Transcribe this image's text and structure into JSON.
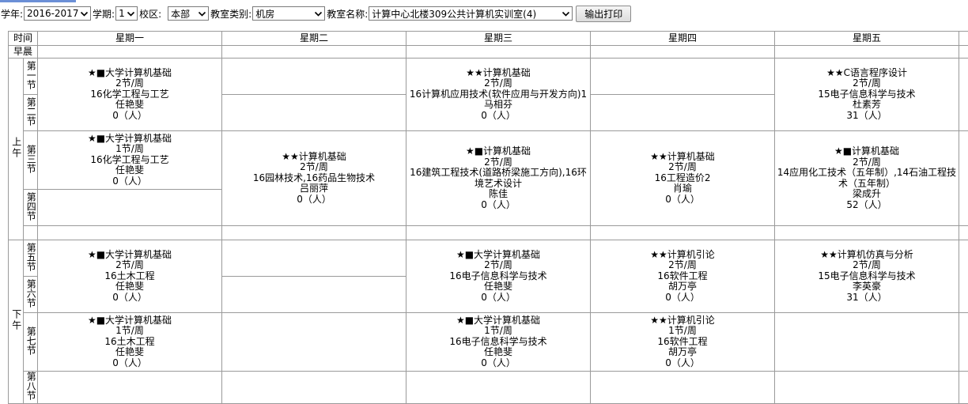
{
  "filters": {
    "year_label": "学年:",
    "year_value": "2016-2017",
    "term_label": "学期:",
    "term_value": "1",
    "campus_label": "校区:",
    "campus_value": "本部",
    "type_label": "教室类别:",
    "type_value": "机房",
    "room_label": "教室名称:",
    "room_value": "计算中心北楼309公共计算机实训室(4)",
    "print_button": "输出打印"
  },
  "table": {
    "time_header": "时间",
    "days": [
      "星期一",
      "星期二",
      "星期三",
      "星期四",
      "星期五"
    ],
    "early": "早晨",
    "am": "上午",
    "pm": "下午",
    "periods": [
      "第一节",
      "第二节",
      "第三节",
      "第四节",
      "第五节",
      "第六节",
      "第七节",
      "第八节"
    ]
  },
  "courses": {
    "mon_12": {
      "name": "★■大学计算机基础",
      "hours": "2节/周",
      "class": "16化学工程与工艺",
      "teacher": "任艳斐",
      "count": "0（人）"
    },
    "wed_12": {
      "name": "★★计算机基础",
      "hours": "2节/周",
      "class": "16计算机应用技术(软件应用与开发方向)1",
      "teacher": "马相芬",
      "count": "0（人）"
    },
    "fri_12": {
      "name": "★★C语言程序设计",
      "hours": "2节/周",
      "class": "15电子信息科学与技术",
      "teacher": "杜素芳",
      "count": "31（人）"
    },
    "mon_3": {
      "name": "★■大学计算机基础",
      "hours": "1节/周",
      "class": "16化学工程与工艺",
      "teacher": "任艳斐",
      "count": "0（人）"
    },
    "tue_34": {
      "name": "★★计算机基础",
      "hours": "2节/周",
      "class": "16园林技术,16药品生物技术",
      "teacher": "吕丽萍",
      "count": "0（人）"
    },
    "wed_34": {
      "name": "★■计算机基础",
      "hours": "2节/周",
      "class": "16建筑工程技术(道路桥梁施工方向),16环境艺术设计",
      "teacher": "陈佳",
      "count": "0（人）"
    },
    "thu_34": {
      "name": "★★计算机基础",
      "hours": "2节/周",
      "class": "16工程造价2",
      "teacher": "肖瑜",
      "count": "0（人）"
    },
    "fri_34": {
      "name": "★■计算机基础",
      "hours": "2节/周",
      "class": "14应用化工技术（五年制）,14石油工程技术（五年制）",
      "teacher": "梁成升",
      "count": "52（人）"
    },
    "mon_56": {
      "name": "★■大学计算机基础",
      "hours": "2节/周",
      "class": "16土木工程",
      "teacher": "任艳斐",
      "count": "0（人）"
    },
    "wed_56": {
      "name": "★■大学计算机基础",
      "hours": "2节/周",
      "class": "16电子信息科学与技术",
      "teacher": "任艳斐",
      "count": "0（人）"
    },
    "thu_56": {
      "name": "★★计算机引论",
      "hours": "2节/周",
      "class": "16软件工程",
      "teacher": "胡万亭",
      "count": "0（人）"
    },
    "fri_56": {
      "name": "★★计算机仿真与分析",
      "hours": "2节/周",
      "class": "15电子信息科学与技术",
      "teacher": "李英豪",
      "count": "31（人）"
    },
    "mon_7": {
      "name": "★■大学计算机基础",
      "hours": "1节/周",
      "class": "16土木工程",
      "teacher": "任艳斐",
      "count": "0（人）"
    },
    "wed_7": {
      "name": "★■大学计算机基础",
      "hours": "1节/周",
      "class": "16电子信息科学与技术",
      "teacher": "任艳斐",
      "count": "0（人）"
    },
    "thu_7": {
      "name": "★★计算机引论",
      "hours": "1节/周",
      "class": "16软件工程",
      "teacher": "胡万亭",
      "count": "0（人）"
    }
  }
}
